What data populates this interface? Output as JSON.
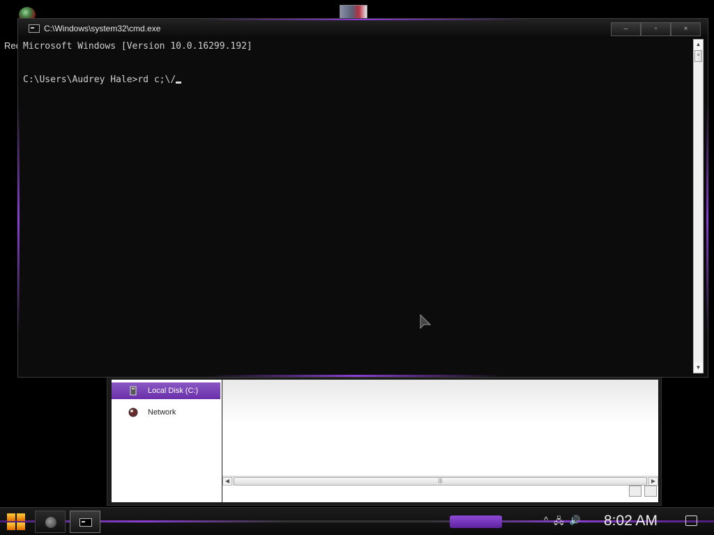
{
  "desktop": {
    "recycle_label": "Recycle Bin"
  },
  "cmd_window": {
    "title": "C:\\Windows\\system32\\cmd.exe",
    "controls": {
      "minimize": "–",
      "maximize": "▫",
      "close": "×"
    },
    "lines": [
      "Microsoft Windows [Version 10.0.16299.192]",
      "",
      "C:\\Users\\Audrey Hale>rd c;\\/"
    ]
  },
  "explorer": {
    "nav_items": [
      {
        "label": "Local Disk (C:)",
        "selected": true
      },
      {
        "label": "Network",
        "selected": false
      }
    ]
  },
  "taskbar": {
    "clock": "8:02 AM",
    "tray_icons": [
      "chevron-up-icon",
      "network-icon",
      "volume-icon"
    ],
    "tray_glyphs": {
      "chevron": "^",
      "network": "🖧",
      "volume": "🔊"
    }
  },
  "colors": {
    "accent": "#8a3fd2",
    "console_bg": "#0c0c0c",
    "console_text": "#cfcfcf"
  }
}
